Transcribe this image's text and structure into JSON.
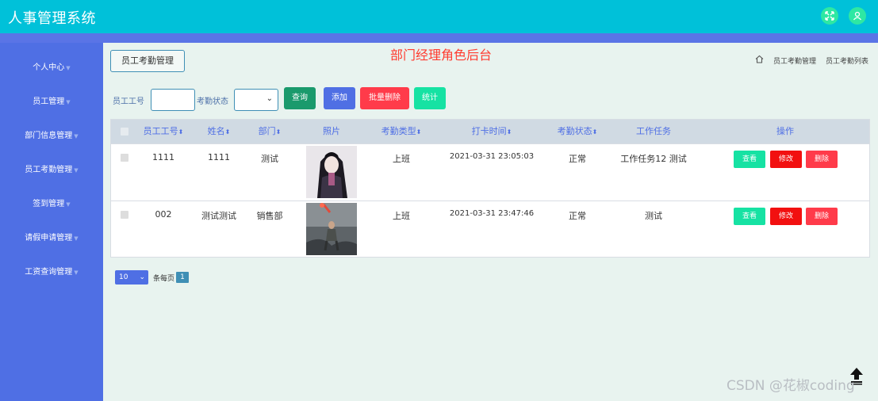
{
  "header": {
    "app_title": "人事管理系统",
    "icons": [
      "expand-icon",
      "user-icon"
    ]
  },
  "sidebar": {
    "items": [
      {
        "label": "个人中心"
      },
      {
        "label": "员工管理"
      },
      {
        "label": "部门信息管理"
      },
      {
        "label": "员工考勤管理"
      },
      {
        "label": "签到管理"
      },
      {
        "label": "请假申请管理"
      },
      {
        "label": "工资查询管理"
      }
    ]
  },
  "main": {
    "tab_label": "员工考勤管理",
    "role_title": "部门经理角色后台",
    "breadcrumb": [
      "员工考勤管理",
      "员工考勤列表"
    ]
  },
  "search": {
    "emp_no_label": "员工工号",
    "emp_no_value": "",
    "status_label": "考勤状态",
    "status_value": "",
    "query_label": "查询",
    "add_label": "添加",
    "batch_delete_label": "批量删除",
    "stats_label": "统计"
  },
  "table": {
    "columns": [
      "员工工号",
      "姓名",
      "部门",
      "照片",
      "考勤类型",
      "打卡时间",
      "考勤状态",
      "工作任务",
      "操作"
    ],
    "rows": [
      {
        "emp_no": "1111",
        "name": "1111",
        "dept": "测试",
        "type": "上班",
        "time": "2021-03-31 23:05:03",
        "status": "正常",
        "task": "工作任务12 测试"
      },
      {
        "emp_no": "002",
        "name": "测试测试",
        "dept": "销售部",
        "type": "上班",
        "time": "2021-03-31 23:47:46",
        "status": "正常",
        "task": "测试"
      }
    ],
    "actions": {
      "view": "查看",
      "edit": "修改",
      "delete": "删除"
    }
  },
  "pager": {
    "page_size": "10",
    "per_page_label": "条每页",
    "current_page": "1"
  },
  "watermark": "CSDN @花椒coding",
  "colors": {
    "topbar": "#00c1d9",
    "sidebar": "#4f6fe4",
    "query": "#1a9a6c",
    "add": "#4f6fe4",
    "batch_delete": "#ff3b4a",
    "stats": "#16e2a3",
    "view": "#16e2a3",
    "edit": "#f21010",
    "delete": "#ff3b4a"
  }
}
